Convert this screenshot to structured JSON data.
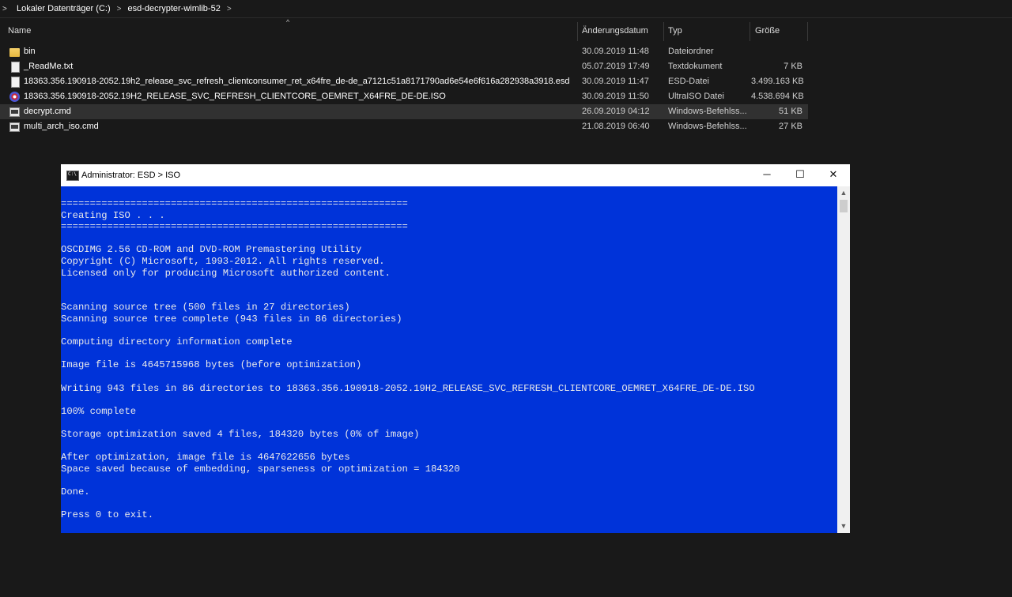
{
  "breadcrumb": {
    "start_glyph": ">",
    "items": [
      "Lokaler Datenträger (C:)",
      "esd-decrypter-wimlib-52"
    ],
    "separator": ">"
  },
  "columns": {
    "name": "Name",
    "date": "Änderungsdatum",
    "type": "Typ",
    "size": "Größe",
    "sort_indicator": "^"
  },
  "files": [
    {
      "icon": "folder-icon",
      "name": "bin",
      "date": "30.09.2019 11:48",
      "type": "Dateiordner",
      "size": ""
    },
    {
      "icon": "text-file-icon",
      "name": "_ReadMe.txt",
      "date": "05.07.2019 17:49",
      "type": "Textdokument",
      "size": "7 KB"
    },
    {
      "icon": "file-icon",
      "name": "18363.356.190918-2052.19h2_release_svc_refresh_clientconsumer_ret_x64fre_de-de_a7121c51a8171790ad6e54e6f616a282938a3918.esd",
      "date": "30.09.2019 11:47",
      "type": "ESD-Datei",
      "size": "3.499.163 KB"
    },
    {
      "icon": "disc-image-icon",
      "name": "18363.356.190918-2052.19H2_RELEASE_SVC_REFRESH_CLIENTCORE_OEMRET_X64FRE_DE-DE.ISO",
      "date": "30.09.2019 11:50",
      "type": "UltraISO Datei",
      "size": "4.538.694 KB"
    },
    {
      "icon": "cmd-file-icon",
      "name": "decrypt.cmd",
      "date": "26.09.2019 04:12",
      "type": "Windows-Befehlss...",
      "size": "51 KB",
      "selected": true
    },
    {
      "icon": "cmd-file-icon",
      "name": "multi_arch_iso.cmd",
      "date": "21.08.2019 06:40",
      "type": "Windows-Befehlss...",
      "size": "27 KB"
    }
  ],
  "console_window": {
    "title": "Administrator:  ESD > ISO",
    "minimize_glyph": "─",
    "maximize_glyph": "☐",
    "close_glyph": "✕",
    "background_color": "#0033d9",
    "lines": [
      "============================================================",
      "Creating ISO . . .",
      "============================================================",
      "",
      "OSCDIMG 2.56 CD-ROM and DVD-ROM Premastering Utility",
      "Copyright (C) Microsoft, 1993-2012. All rights reserved.",
      "Licensed only for producing Microsoft authorized content.",
      "",
      "",
      "Scanning source tree (500 files in 27 directories)",
      "Scanning source tree complete (943 files in 86 directories)",
      "",
      "Computing directory information complete",
      "",
      "Image file is 4645715968 bytes (before optimization)",
      "",
      "Writing 943 files in 86 directories to 18363.356.190918-2052.19H2_RELEASE_SVC_REFRESH_CLIENTCORE_OEMRET_X64FRE_DE-DE.ISO",
      "",
      "100% complete",
      "",
      "Storage optimization saved 4 files, 184320 bytes (0% of image)",
      "",
      "After optimization, image file is 4647622656 bytes",
      "Space saved because of embedding, sparseness or optimization = 184320",
      "",
      "Done.",
      "",
      "Press 0 to exit."
    ]
  }
}
